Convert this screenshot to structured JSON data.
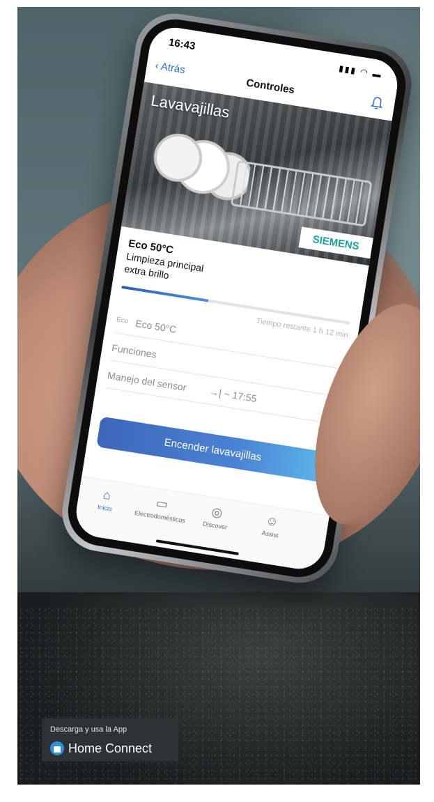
{
  "status": {
    "time": "16:43",
    "icons": "▮▮▮ ◠ ▬"
  },
  "nav": {
    "back": "Atrás",
    "title": "Controles"
  },
  "hero": {
    "title": "Lavavajillas",
    "brand": "SIEMENS"
  },
  "program": {
    "name": "Eco 50°C",
    "line1": "Limpieza principal",
    "line2": "extra brillo",
    "progress_fraction": 0.38,
    "remaining": "Tiempo restante 1 h 12 min"
  },
  "rows": [
    {
      "small": "Eco",
      "label": "Eco 50°C"
    },
    {
      "label": "Funciones",
      "chev": "›"
    },
    {
      "label": "Manejo del sensor",
      "value": "→| ~ 17:55",
      "chev": "›"
    }
  ],
  "cta": {
    "label": "Encender lavavajillas"
  },
  "tabs": [
    {
      "label": "Inicio",
      "icon": "⌂"
    },
    {
      "label": "Electrodomésticos",
      "icon": "▭"
    },
    {
      "label": "Discover",
      "icon": "◎"
    },
    {
      "label": "Assist",
      "icon": "☺"
    }
  ],
  "badge": {
    "caption": "Descarga y usa la App",
    "name": "Home Connect"
  },
  "colors": {
    "accent": "#2a6fdb",
    "brand": "#1aa0a8",
    "cta_end": "#5eb6ea"
  }
}
